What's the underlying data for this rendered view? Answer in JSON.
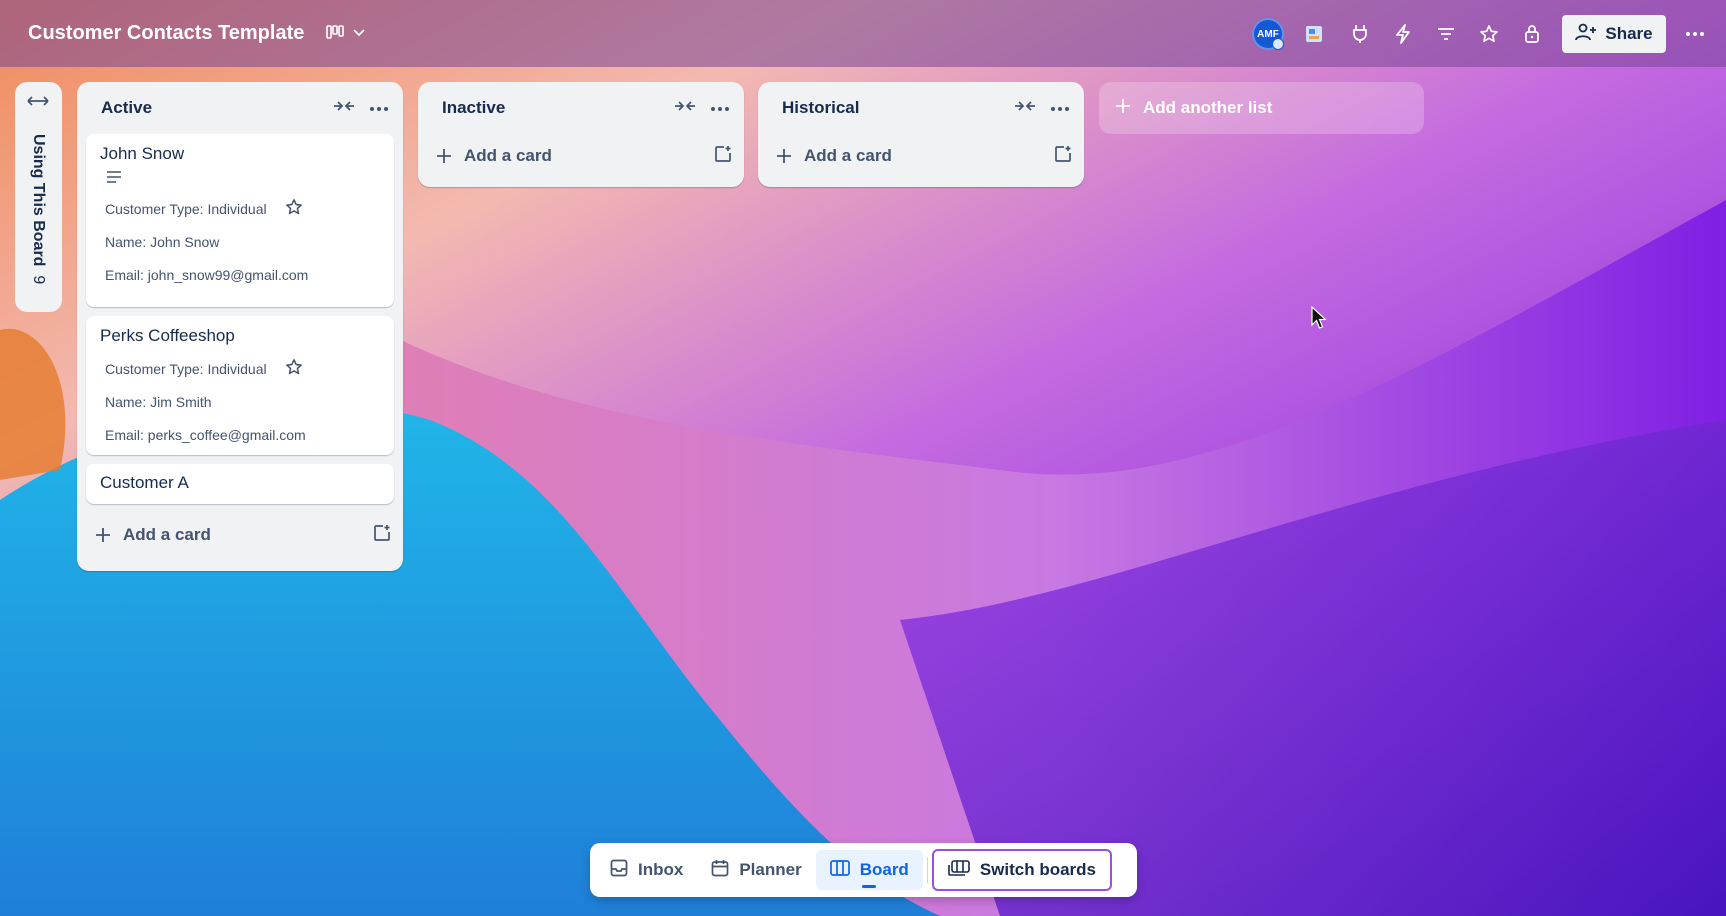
{
  "header": {
    "board_title": "Customer Contacts Template",
    "avatar_initials": "AMF",
    "share_label": "Share",
    "icons": [
      "board-view-icon",
      "chevron-down-icon",
      "power-ups-icon",
      "plug-icon",
      "lightning-icon",
      "filter-icon",
      "star-icon",
      "lock-icon",
      "more-icon"
    ]
  },
  "sidebar": {
    "tab_label": "Using This Board",
    "tab_count": "9"
  },
  "lists": [
    {
      "title": "Active",
      "cards": [
        {
          "title": "John Snow",
          "customer_type": "Customer Type: Individual",
          "name": "Name: John Snow",
          "email": "Email: john_snow99@gmail.com"
        },
        {
          "title": "Perks Coffeeshop",
          "customer_type": "Customer Type: Individual",
          "name": "Name: Jim Smith",
          "email": "Email: perks_coffee@gmail.com"
        },
        {
          "title": "Customer A"
        }
      ],
      "add_card_label": "Add a card"
    },
    {
      "title": "Inactive",
      "add_card_label": "Add a card"
    },
    {
      "title": "Historical",
      "add_card_label": "Add a card"
    }
  ],
  "add_list_label": "Add another list",
  "bottom_nav": {
    "inbox": "Inbox",
    "planner": "Planner",
    "board": "Board",
    "switch_boards": "Switch boards",
    "active": "Board"
  },
  "colors": {
    "accent": "#0c66e4",
    "list_bg": "#f1f2f4",
    "switch_border": "#9c4fd8"
  }
}
